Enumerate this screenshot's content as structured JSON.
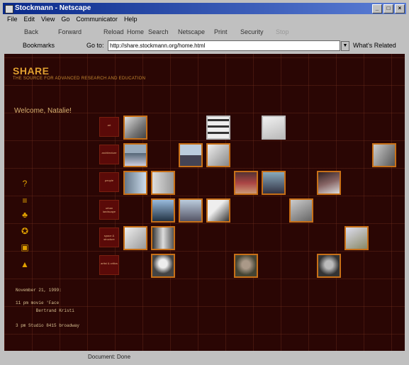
{
  "window": {
    "title": "Stockmann - Netscape"
  },
  "menu": [
    "File",
    "Edit",
    "View",
    "Go",
    "Communicator",
    "Help"
  ],
  "toolbar": [
    "Back",
    "Forward",
    "Reload",
    "Home",
    "Search",
    "Netscape",
    "Print",
    "Security",
    "Stop"
  ],
  "location": {
    "bookmarks": "Bookmarks",
    "label": "Go to:",
    "url": "http://share.stockmann.org/home.html",
    "related": "What's Related"
  },
  "page": {
    "brand": "SHARE",
    "tagline": "THE SOURCE FOR ADVANCED RESEARCH AND EDUCATION",
    "welcome": "Welcome, Natalie!",
    "side_icons": [
      "question-icon",
      "eye-icon",
      "network-icon",
      "gear-icon",
      "film-icon",
      "tower-icon"
    ],
    "categories": [
      "art",
      "architecture",
      "people",
      "urban landscape",
      "space & structure",
      "artist & critics"
    ],
    "info": [
      "November 21, 1999:",
      "11 pm movie 'Face",
      "        Bertrand Kristi",
      "3 pm Studio 8415 broadway"
    ]
  },
  "status": {
    "text1": "",
    "text2": "Document: Done"
  }
}
